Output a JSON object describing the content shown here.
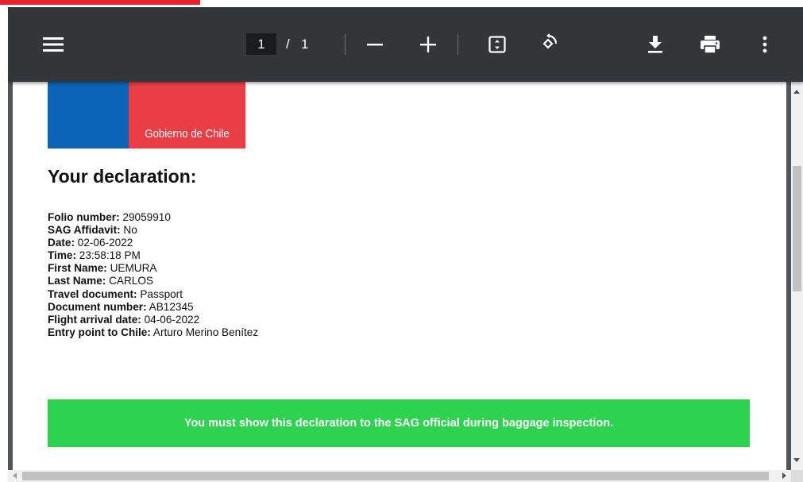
{
  "toolbar": {
    "current_page": "1",
    "page_separator": "/",
    "total_pages": "1",
    "icons": [
      "menu-icon",
      "zoom-out-icon",
      "zoom-in-icon",
      "fit-to-page-icon",
      "rotate-icon",
      "download-icon",
      "print-icon",
      "more-options-icon"
    ]
  },
  "document": {
    "logo_text": "Gobierno de Chile",
    "heading": "Your declaration:",
    "fields": [
      {
        "label": "Folio number:",
        "value": "29059910"
      },
      {
        "label": "SAG Affidavit:",
        "value": "No"
      },
      {
        "label": "Date:",
        "value": "02-06-2022"
      },
      {
        "label": "Time:",
        "value": "23:58:18 PM"
      },
      {
        "label": "First Name:",
        "value": "UEMURA"
      },
      {
        "label": "Last Name:",
        "value": "CARLOS"
      },
      {
        "label": "Travel document:",
        "value": "Passport"
      },
      {
        "label": "Document number:",
        "value": "AB12345"
      },
      {
        "label": "Flight arrival date:",
        "value": "04-06-2022"
      },
      {
        "label": "Entry point to Chile:",
        "value": "Arturo Merino Benítez"
      }
    ],
    "notice": "You must show this declaration to the SAG official during baggage inspection."
  },
  "colors": {
    "toolbar": "#323639",
    "logo_blue": "#0b64b8",
    "logo_red": "#ea3e46",
    "notice_green": "#2dd24f",
    "top_accent": "#e8222d"
  }
}
